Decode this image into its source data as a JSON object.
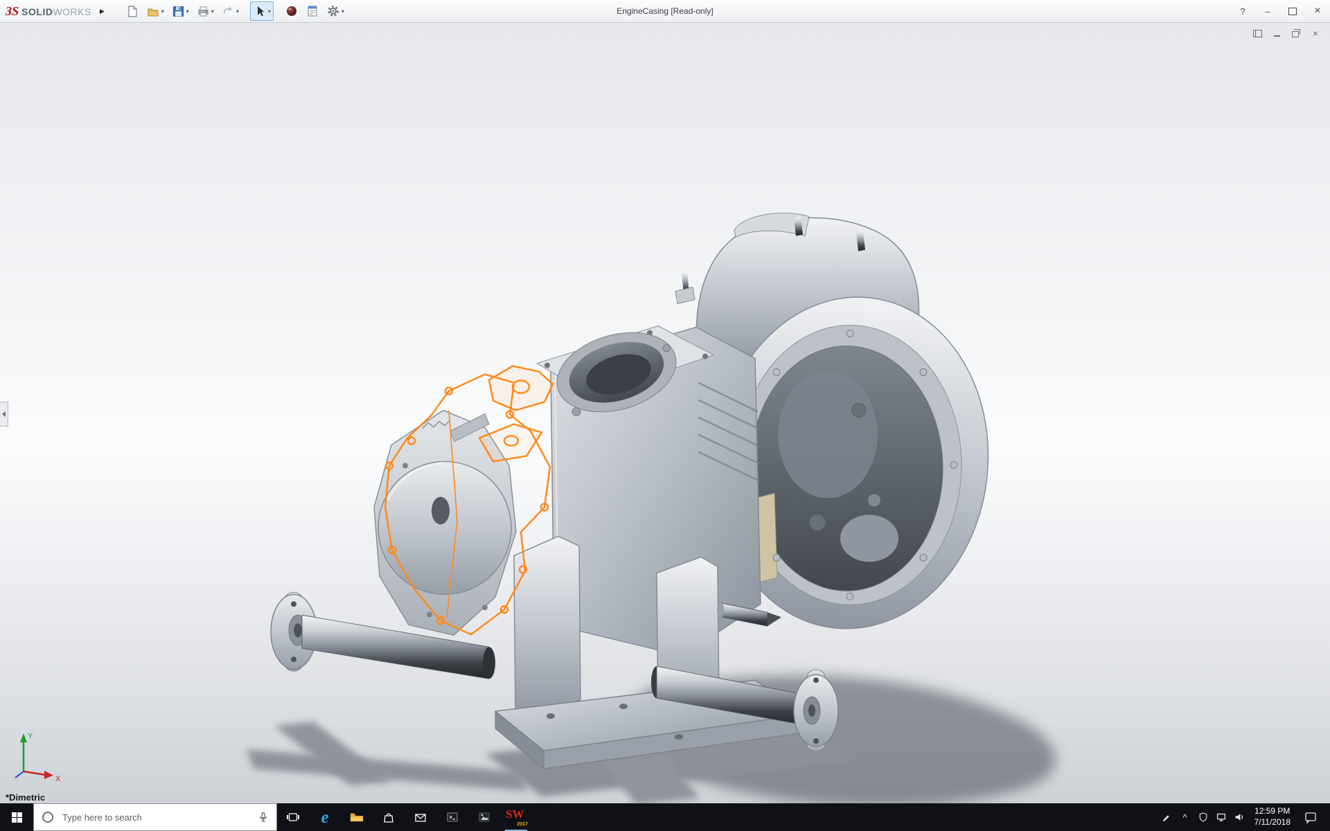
{
  "icons": {
    "flyout": "▶",
    "caret": "▾",
    "help": "?",
    "minimize": "–",
    "close": "×",
    "chevron_up": "^",
    "edge": "e"
  },
  "titlebar": {
    "logo_mark": "ЗS",
    "logo_solid": "SOLID",
    "logo_works": "WORKS",
    "document_title": "EngineCasing [Read-only]"
  },
  "viewport": {
    "view_orientation_label": "*Dimetric",
    "triad_x": "X",
    "triad_y": "Y",
    "selection_color": "#ff8a1e",
    "background_top": "#e6e8ec",
    "background_bottom": "#ced1d6"
  },
  "taskbar": {
    "search_placeholder": "Type here to search",
    "clock_time": "12:59 PM",
    "clock_date": "7/11/2018",
    "sw_badge": "SW",
    "sw_year": "2017",
    "background": "#101116"
  }
}
